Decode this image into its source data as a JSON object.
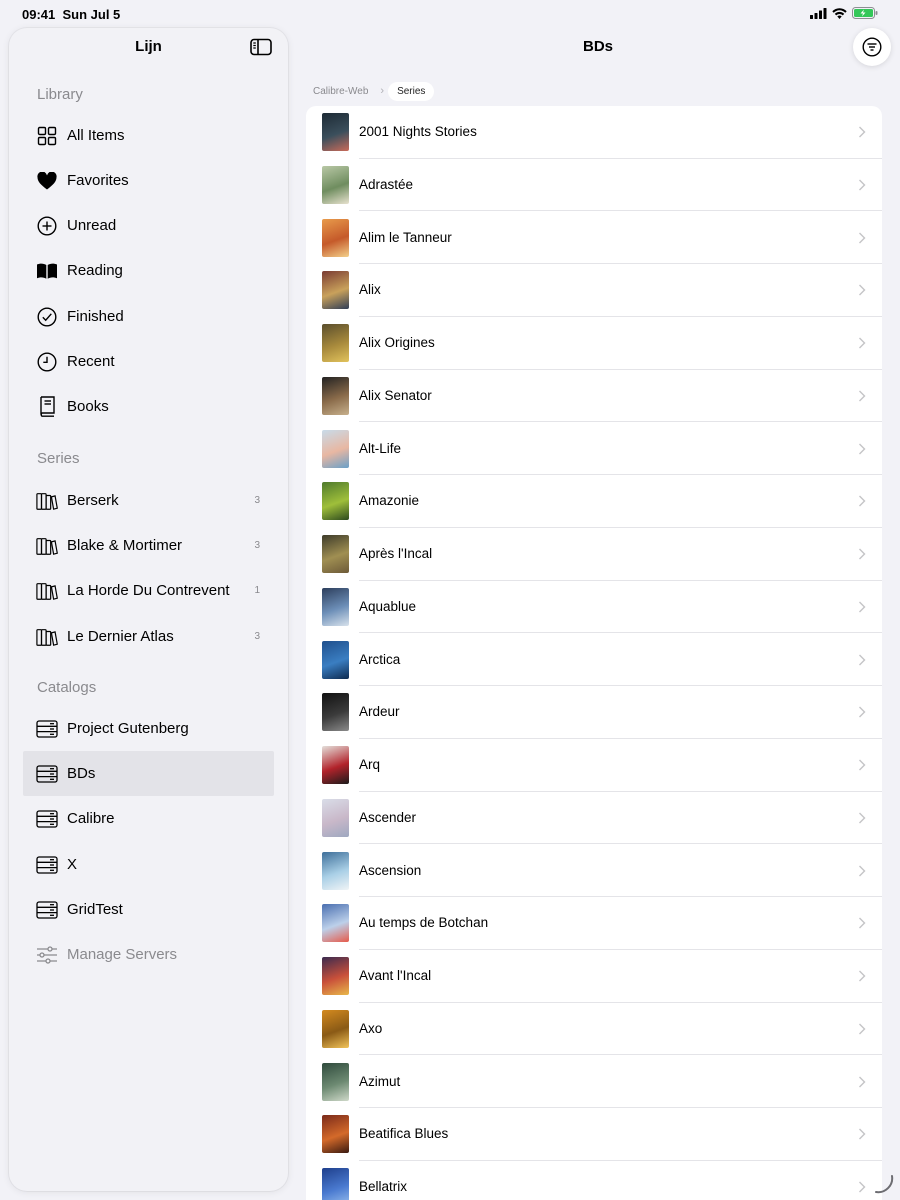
{
  "status": {
    "time": "09:41",
    "date": "Sun Jul 5"
  },
  "sidebar": {
    "title": "Lijn",
    "library_header": "Library",
    "library": [
      {
        "label": "All Items",
        "icon": "grid-icon"
      },
      {
        "label": "Favorites",
        "icon": "heart-icon"
      },
      {
        "label": "Unread",
        "icon": "plus-circle-icon"
      },
      {
        "label": "Reading",
        "icon": "book-open-icon"
      },
      {
        "label": "Finished",
        "icon": "checkmark-circle-icon"
      },
      {
        "label": "Recent",
        "icon": "clock-icon"
      },
      {
        "label": "Books",
        "icon": "book-icon"
      }
    ],
    "series_header": "Series",
    "series": [
      {
        "label": "Berserk",
        "count": "3",
        "icon": "books-vertical-icon"
      },
      {
        "label": "Blake & Mortimer",
        "count": "3",
        "icon": "books-vertical-icon"
      },
      {
        "label": "La Horde Du Contrevent",
        "count": "1",
        "icon": "books-vertical-icon"
      },
      {
        "label": "Le Dernier Atlas",
        "count": "3",
        "icon": "books-vertical-icon"
      }
    ],
    "catalogs_header": "Catalogs",
    "catalogs": [
      {
        "label": "Project Gutenberg",
        "icon": "server-icon"
      },
      {
        "label": "BDs",
        "icon": "server-icon",
        "selected": true
      },
      {
        "label": "Calibre",
        "icon": "server-icon"
      },
      {
        "label": "X",
        "icon": "server-icon"
      },
      {
        "label": "GridTest",
        "icon": "server-icon"
      },
      {
        "label": "Manage Servers",
        "icon": "sliders-icon",
        "dim": true
      }
    ]
  },
  "main": {
    "title": "BDs",
    "breadcrumb": {
      "parent": "Calibre-Web",
      "current": "Series"
    },
    "rows": [
      {
        "title": "2001 Nights Stories",
        "cover": [
          "#1d2a35",
          "#3b4f5c",
          "#c96b5a"
        ]
      },
      {
        "title": "Adrastée",
        "cover": [
          "#b9c8a6",
          "#6f8d5f",
          "#e8e2cf"
        ]
      },
      {
        "title": "Alim le Tanneur",
        "cover": [
          "#e89b4b",
          "#c55a2a",
          "#f3d08b"
        ]
      },
      {
        "title": "Alix",
        "cover": [
          "#7a3b32",
          "#c9a15b",
          "#2f3d57"
        ]
      },
      {
        "title": "Alix Origines",
        "cover": [
          "#5a4e2d",
          "#a88a3c",
          "#e2c35c"
        ]
      },
      {
        "title": "Alix Senator",
        "cover": [
          "#222222",
          "#8a6b4a",
          "#c7b08c"
        ]
      },
      {
        "title": "Alt-Life",
        "cover": [
          "#c8dbe9",
          "#e8b7a2",
          "#6aa0c8"
        ]
      },
      {
        "title": "Amazonie",
        "cover": [
          "#4f7a2c",
          "#9fbf3a",
          "#2d4a1e"
        ]
      },
      {
        "title": "Après l'Incal",
        "cover": [
          "#3d3b2a",
          "#a08f52",
          "#6d5a38"
        ]
      },
      {
        "title": "Aquablue",
        "cover": [
          "#2c3e5c",
          "#6d8fb8",
          "#d8e2ec"
        ]
      },
      {
        "title": "Arctica",
        "cover": [
          "#1f4f8c",
          "#3a7ec2",
          "#0e2a4f"
        ]
      },
      {
        "title": "Ardeur",
        "cover": [
          "#111111",
          "#3b3b3b",
          "#8a8a8a"
        ]
      },
      {
        "title": "Arq",
        "cover": [
          "#e4e0db",
          "#b2232b",
          "#1b1b1b"
        ]
      },
      {
        "title": "Ascender",
        "cover": [
          "#d9dde8",
          "#c9b8c9",
          "#9ea8c0"
        ]
      },
      {
        "title": "Ascension",
        "cover": [
          "#3e6f9a",
          "#a9cfe6",
          "#f0f4f6"
        ]
      },
      {
        "title": "Au temps de Botchan",
        "cover": [
          "#4a6fb0",
          "#bcd0ea",
          "#e65a4a"
        ]
      },
      {
        "title": "Avant l'Incal",
        "cover": [
          "#3b2a4f",
          "#c9503a",
          "#e8b84a"
        ]
      },
      {
        "title": "Axo",
        "cover": [
          "#d48a1f",
          "#8a5a16",
          "#f2c45a"
        ]
      },
      {
        "title": "Azimut",
        "cover": [
          "#2f4a3c",
          "#6d8a72",
          "#cfd9c9"
        ]
      },
      {
        "title": "Beatifica Blues",
        "cover": [
          "#7a2a1a",
          "#d46a2a",
          "#3a1a10"
        ]
      },
      {
        "title": "Bellatrix",
        "cover": [
          "#1e3f8c",
          "#4a7ad0",
          "#9ac0ee"
        ]
      }
    ]
  }
}
